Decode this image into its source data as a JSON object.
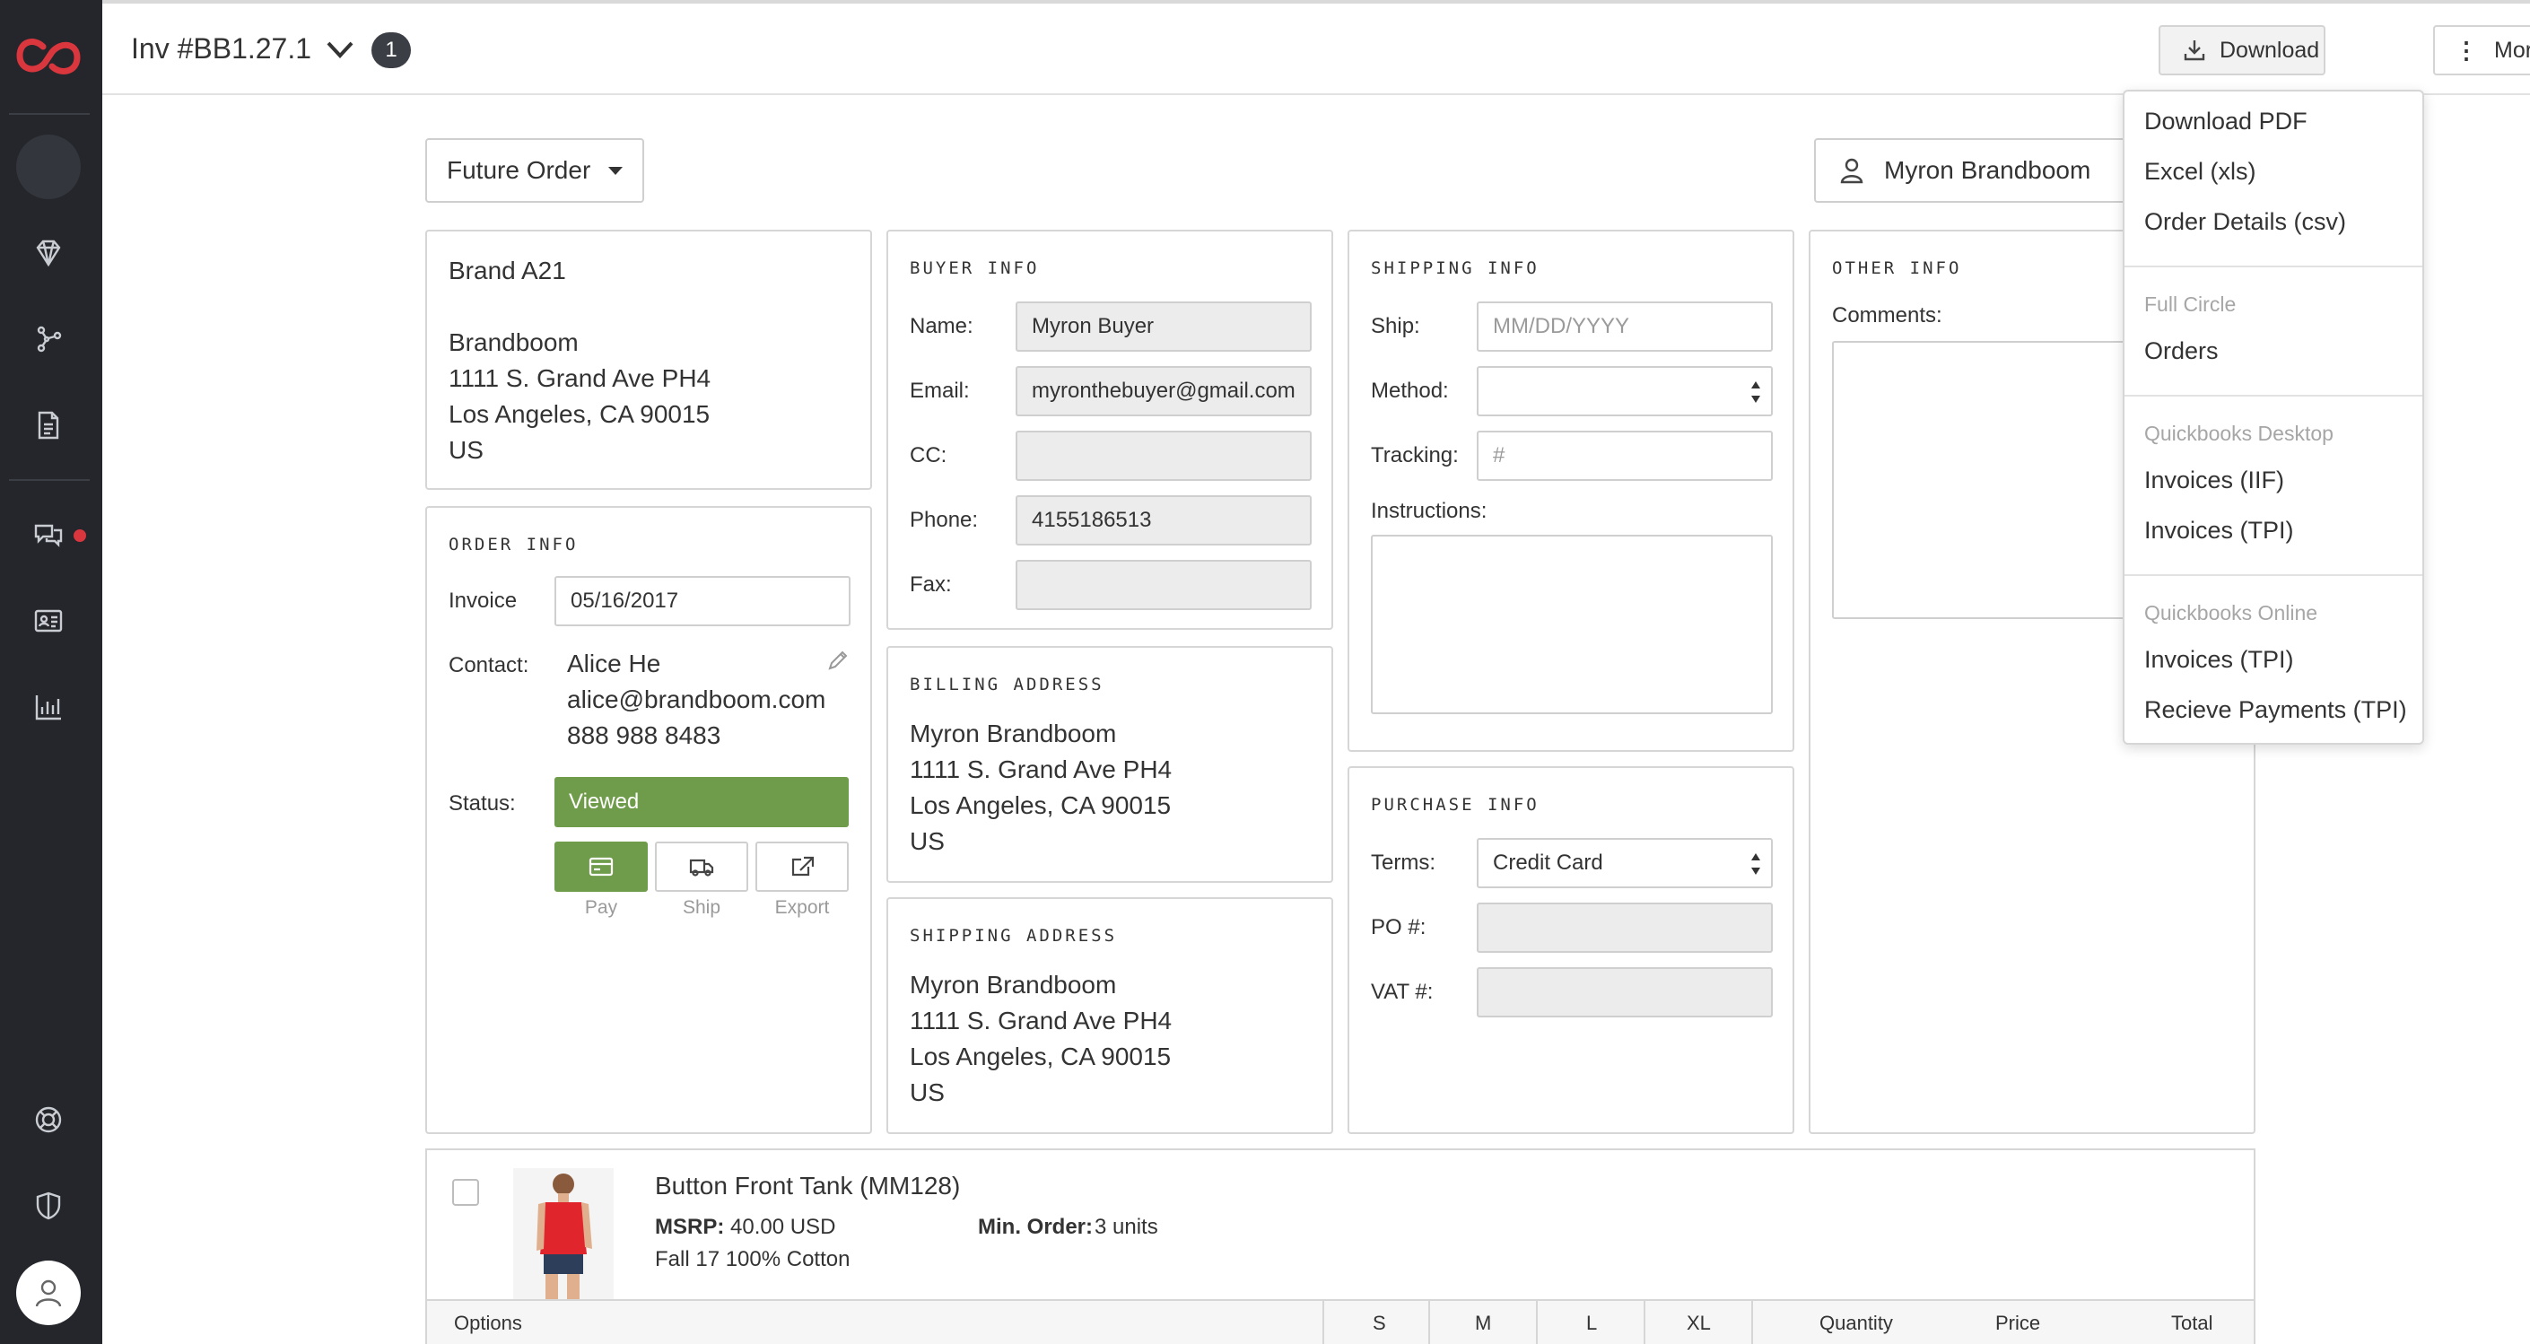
{
  "header": {
    "invoice_title": "Inv #BB1.27.1",
    "badge_count": "1",
    "download_label": "Download",
    "more_label": "More"
  },
  "toolbar": {
    "order_type": "Future Order",
    "buyer_name": "Myron Brandboom"
  },
  "brand_card": {
    "brand": "Brand A21",
    "company": "Brandboom",
    "address1": "1111 S. Grand Ave PH4",
    "address2": "Los Angeles, CA 90015",
    "country": "US"
  },
  "order_info": {
    "title": "ORDER INFO",
    "invoice_label": "Invoice",
    "invoice_date": "05/16/2017",
    "contact_label": "Contact:",
    "contact_name": "Alice He",
    "contact_email": "alice@brandboom.com",
    "contact_phone": "888 988 8483",
    "status_label": "Status:",
    "status_value": "Viewed",
    "status_color": "#6f9c4a",
    "actions": [
      "Pay",
      "Ship",
      "Export"
    ]
  },
  "buyer_info": {
    "title": "BUYER INFO",
    "name_label": "Name:",
    "name_value": "Myron Buyer",
    "email_label": "Email:",
    "email_value": "myronthebuyer@gmail.com",
    "cc_label": "CC:",
    "cc_value": "",
    "phone_label": "Phone:",
    "phone_value": "4155186513",
    "fax_label": "Fax:",
    "fax_value": ""
  },
  "billing_address": {
    "title": "BILLING ADDRESS",
    "name": "Myron Brandboom",
    "address1": "1111 S. Grand Ave PH4",
    "address2": "Los Angeles, CA 90015",
    "country": "US"
  },
  "shipping_address": {
    "title": "SHIPPING ADDRESS",
    "name": "Myron Brandboom",
    "address1": "1111 S. Grand Ave PH4",
    "address2": "Los Angeles, CA 90015",
    "country": "US"
  },
  "shipping_info": {
    "title": "SHIPPING INFO",
    "ship_label": "Ship:",
    "ship_placeholder": "MM/DD/YYYY",
    "method_label": "Method:",
    "method_value": "",
    "tracking_label": "Tracking:",
    "tracking_placeholder": "#",
    "instructions_label": "Instructions:"
  },
  "purchase_info": {
    "title": "PURCHASE INFO",
    "terms_label": "Terms:",
    "terms_value": "Credit Card",
    "po_label": "PO #:",
    "po_value": "",
    "vat_label": "VAT #:",
    "vat_value": ""
  },
  "other_info": {
    "title": "OTHER INFO",
    "comments_label": "Comments:"
  },
  "product": {
    "name": "Button Front Tank (MM128)",
    "msrp_label": "MSRP:",
    "msrp_value": "40.00 USD",
    "min_order_label": "Min. Order:",
    "min_order_value": "3 units",
    "description": "Fall 17 100% Cotton",
    "table_headers": [
      "Options",
      "S",
      "M",
      "L",
      "XL",
      "Quantity",
      "Price",
      "Total"
    ]
  },
  "download_menu": {
    "items_top": [
      "Download PDF",
      "Excel (xls)",
      "Order Details (csv)"
    ],
    "group_full_circle": "Full Circle",
    "full_circle_items": [
      "Orders"
    ],
    "group_qb_desktop": "Quickbooks Desktop",
    "qb_desktop_items": [
      "Invoices (IIF)",
      "Invoices (TPI)"
    ],
    "group_qb_online": "Quickbooks Online",
    "qb_online_items": [
      "Invoices (TPI)",
      "Recieve Payments (TPI)"
    ]
  },
  "icons": {
    "logo": "brandboom-logo",
    "sidebar": [
      "diamond-icon",
      "network-icon",
      "document-icon",
      "chat-icon",
      "contact-card-icon",
      "bar-chart-icon",
      "lifebuoy-icon",
      "shield-icon",
      "user-icon"
    ]
  },
  "colors": {
    "sidebar_bg": "#24262b",
    "brand_red": "#d9363e",
    "status_green": "#6f9c4a"
  }
}
